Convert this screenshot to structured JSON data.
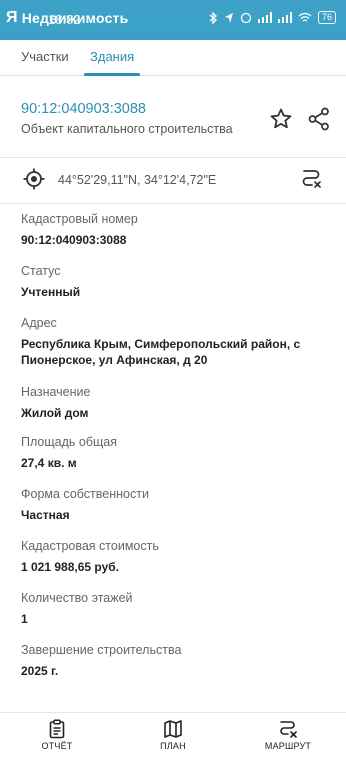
{
  "status_bar": {
    "logo": "Я",
    "app_name": "Недвижимость",
    "time": "18:02",
    "battery": "76"
  },
  "tabs": [
    {
      "label": "Участки",
      "active": false
    },
    {
      "label": "Здания",
      "active": true
    }
  ],
  "header": {
    "cadastral_link": "90:12:040903:3088",
    "object_type": "Объект капитального строительства",
    "star_icon": "star-outline-icon",
    "share_icon": "share-icon"
  },
  "coords": {
    "text": "44°52'29,11\"N, 34°12'4,72\"E",
    "locate_icon": "crosshair-icon",
    "route_icon": "route-icon"
  },
  "fields": [
    {
      "label": "Кадастровый номер",
      "value": "90:12:040903:3088"
    },
    {
      "label": "Статус",
      "value": "Учтенный"
    },
    {
      "label": "Адрес",
      "value": "Республика Крым, Симферопольский район, с Пионерское, ул Афинская, д 20"
    },
    {
      "label": "Назначение",
      "value": "Жилой дом"
    },
    {
      "label": "Площадь общая",
      "value": "27,4 кв. м"
    },
    {
      "label": "Форма собственности",
      "value": "Частная"
    },
    {
      "label": "Кадастровая стоимость",
      "value": "1 021 988,65 руб."
    },
    {
      "label": "Количество этажей",
      "value": "1"
    },
    {
      "label": "Завершение строительства",
      "value": "2025 г."
    }
  ],
  "bottom_nav": [
    {
      "label": "ОТЧЁТ",
      "icon": "report-icon"
    },
    {
      "label": "ПЛАН",
      "icon": "map-icon"
    },
    {
      "label": "МАРШРУТ",
      "icon": "route-icon"
    }
  ],
  "colors": {
    "accent": "#2e8eb5",
    "status_bar": "#3ba0c6"
  }
}
